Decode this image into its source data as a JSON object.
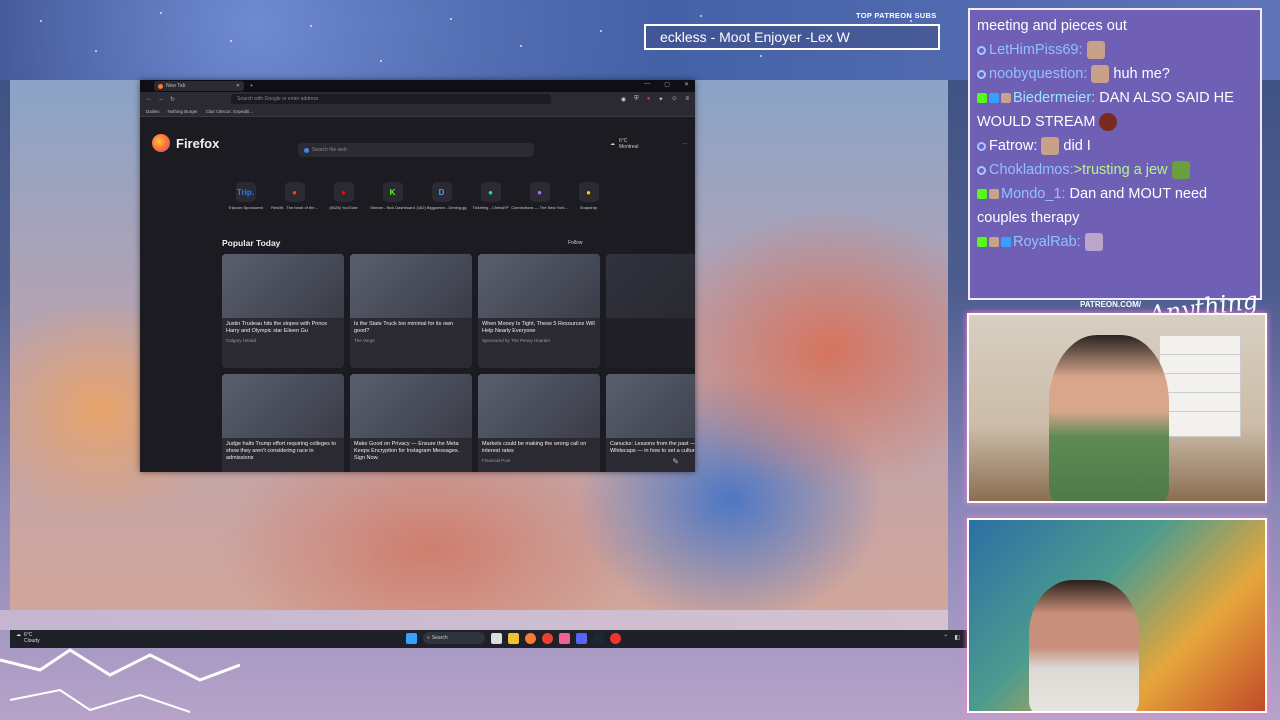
{
  "overlay": {
    "patreon_label": "TOP PATREON SUBS",
    "marquee_text": "eckless - Moot Enjoyer -Lex W",
    "patreon_url": "PATREON.COM/",
    "brand_script": "Anything Else"
  },
  "browser": {
    "tab_title": "New Tab",
    "url_placeholder": "Search with Google or enter address",
    "bookmarks": [
      "Dailies",
      "Nothing Burger",
      "Clair Obscur: Expediti..."
    ],
    "brand": "Firefox",
    "search_placeholder": "Search the web",
    "weather": {
      "temp": "6°C",
      "city": "Montreal"
    },
    "shortcuts": [
      {
        "label": "Tripcom Sponsored",
        "icon": "Trip.",
        "color": "#2f7bf5"
      },
      {
        "label": "Reddit - The heart of the...",
        "icon": "reddit-icon",
        "color": "#ff4500"
      },
      {
        "label": "(8428) YouTube",
        "icon": "youtube-icon",
        "color": "#ff0000"
      },
      {
        "label": "Stream - Kick Dashboard",
        "icon": "K",
        "color": "#53fc18"
      },
      {
        "label": "(162) Biggomen - Dexing.gg",
        "icon": "D",
        "color": "#3aa0ff"
      },
      {
        "label": "Ticketing - ChessKP",
        "icon": "ticket-icon",
        "color": "#2adf9b"
      },
      {
        "label": "Connections — The New York...",
        "icon": "grid-icon",
        "color": "#b36bff"
      },
      {
        "label": "Snapdrop",
        "icon": "arrow-icon",
        "color": "#f2d300"
      }
    ],
    "popular_heading": "Popular Today",
    "follow_label": "Follow",
    "cards": [
      {
        "title": "Justin Trudeau hits the slopes with Prince Harry and Olympic star Eileen Gu",
        "source": "Calgary Herald"
      },
      {
        "title": "Is the State Truck too minimal for its own good?",
        "source": "The Verge"
      },
      {
        "title": "When Money Is Tight, These 5 Resources Will Help Nearly Everyone",
        "source": "Sponsored by The Penny Hoarder"
      },
      {
        "title": "",
        "source": ""
      },
      {
        "title": "Judge halts Trump effort requiring colleges to show they aren't considering race in admissions",
        "source": ""
      },
      {
        "title": "Make Good on Privacy — Ensure the Meta Keeps Encryption for Instagram Messages. Sign Now.",
        "source": ""
      },
      {
        "title": "Markets could be making the wrong call on interest rates",
        "source": "Financial Post"
      },
      {
        "title": "Canucks: Lessons from the past — and the Whitecaps — in how to set a culture",
        "source": ""
      }
    ]
  },
  "taskbar": {
    "weather_temp": "6°C",
    "weather_desc": "Cloudy",
    "search_label": "Search"
  },
  "chat": {
    "messages": [
      {
        "user": "",
        "text": "meeting and pieces out",
        "user_color": "#ffffff"
      },
      {
        "user": "LetHimPiss69:",
        "text": "",
        "user_color": "#8fc2ff"
      },
      {
        "user": "noobyquestion:",
        "text": "huh me?",
        "user_color": "#8fc2ff"
      },
      {
        "user": "Biedermeier:",
        "text": "DAN ALSO SAID HE WOULD STREAM",
        "user_color": "#9be7ff"
      },
      {
        "user": "Fatrow:",
        "text": "did I",
        "user_color": "#ffffff"
      },
      {
        "user": "Chokladmos:",
        "text": ">trusting a jew",
        "user_color": "#8fc2ff"
      },
      {
        "user": "Mondo_1:",
        "text": "Dan and MOUT need couples therapy",
        "user_color": "#8fc2ff"
      },
      {
        "user": "RoyalRab:",
        "text": "",
        "user_color": "#8fc2ff"
      }
    ]
  }
}
